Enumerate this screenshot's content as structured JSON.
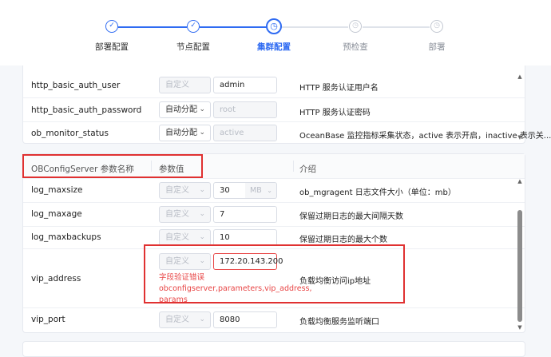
{
  "steps": [
    {
      "label": "部署配置",
      "state": "done"
    },
    {
      "label": "节点配置",
      "state": "done"
    },
    {
      "label": "集群配置",
      "state": "active"
    },
    {
      "label": "预检查",
      "state": "todo"
    },
    {
      "label": "部署",
      "state": "todo"
    }
  ],
  "icons": {
    "done": "✓",
    "active": "◷",
    "todo": "◷",
    "chevron": "⌄",
    "scroll_up": "▲",
    "scroll_down": "▼"
  },
  "card1": {
    "rows": [
      {
        "name": "http_basic_auth_user",
        "mode": "自定义",
        "mode_enabled": false,
        "value": "admin",
        "value_disabled": false,
        "desc": "HTTP 服务认证用户名"
      },
      {
        "name": "http_basic_auth_password",
        "mode": "自动分配",
        "mode_enabled": true,
        "value": "root",
        "value_disabled": true,
        "desc": "HTTP 服务认证密码"
      },
      {
        "name": "ob_monitor_status",
        "mode": "自动分配",
        "mode_enabled": true,
        "value": "active",
        "value_disabled": true,
        "desc": "OceanBase 监控指标采集状态，active 表示开启，inactive 表示关..."
      }
    ]
  },
  "card2": {
    "header": {
      "param_name": "OBConfigServer 参数名称",
      "param_value": "参数值",
      "intro": "介绍"
    },
    "rows": [
      {
        "name": "log_maxsize",
        "mode": "自定义",
        "value": "30",
        "unit": "MB",
        "desc": "ob_mgragent 日志文件大小（单位：mb）"
      },
      {
        "name": "log_maxage",
        "mode": "自定义",
        "value": "7",
        "desc": "保留过期日志的最大间隔天数"
      },
      {
        "name": "log_maxbackups",
        "mode": "自定义",
        "value": "10",
        "desc": "保留过期日志的最大个数"
      },
      {
        "name": "vip_address",
        "mode": "自定义",
        "value": "172.20.143.200",
        "desc": "负载均衡访问ip地址",
        "error_title": "字段验证错误",
        "error_detail": "obconfigserver,parameters,vip_address,",
        "error_tail": "params"
      },
      {
        "name": "vip_port",
        "mode": "自定义",
        "value": "8080",
        "desc": "负载均衡服务监听端口"
      }
    ]
  },
  "colors": {
    "primary": "#2f6bf2",
    "error": "#e84545",
    "highlight_box": "#e03131"
  }
}
